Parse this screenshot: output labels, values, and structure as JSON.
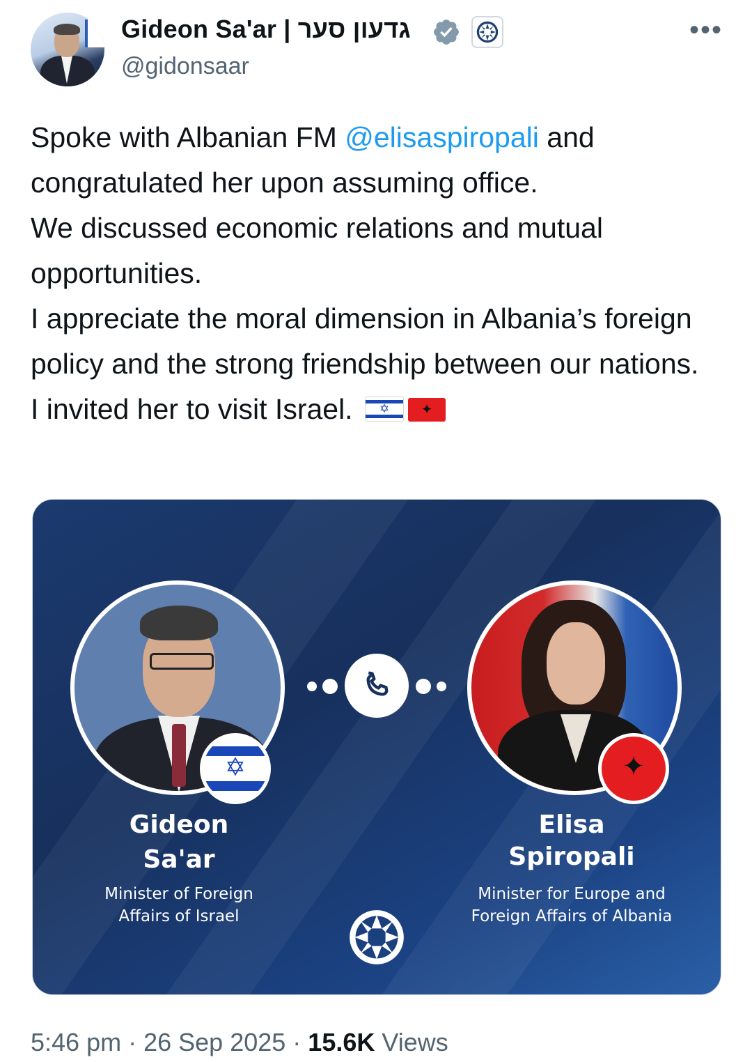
{
  "author": {
    "display_name": "Gideon Sa'ar | גדעון סער",
    "handle": "@gidonsaar"
  },
  "tweet": {
    "line1_pre": "Spoke with Albanian FM ",
    "mention": "@elisaspiropali",
    "line1_post": " and congratulated her upon assuming office.",
    "para2": "We discussed economic relations and mutual opportunities.",
    "para3": "I appreciate the moral dimension in Albania’s foreign policy and the strong friendship between our nations.",
    "para4": "I invited her to visit Israel."
  },
  "card": {
    "left_person": {
      "first": "Gideon",
      "last": "Sa'ar",
      "role_line1": "Minister of Foreign",
      "role_line2": "Affairs of Israel"
    },
    "right_person": {
      "first": "Elisa",
      "last": "Spiropali",
      "role_line1": "Minister for Europe and",
      "role_line2": "Foreign Affairs of Albania"
    }
  },
  "meta": {
    "time": "5:46 pm",
    "date": "26 Sep 2025",
    "views_count": "15.6K",
    "views_label": "Views"
  },
  "icons": {
    "verified": "verified-badge-icon",
    "org": "mfa-logo-icon",
    "more": "more-options-icon",
    "phone": "phone-icon"
  },
  "colors": {
    "link": "#1d9bf0",
    "card_blue": "#17305d",
    "secondary_text": "#536471"
  }
}
